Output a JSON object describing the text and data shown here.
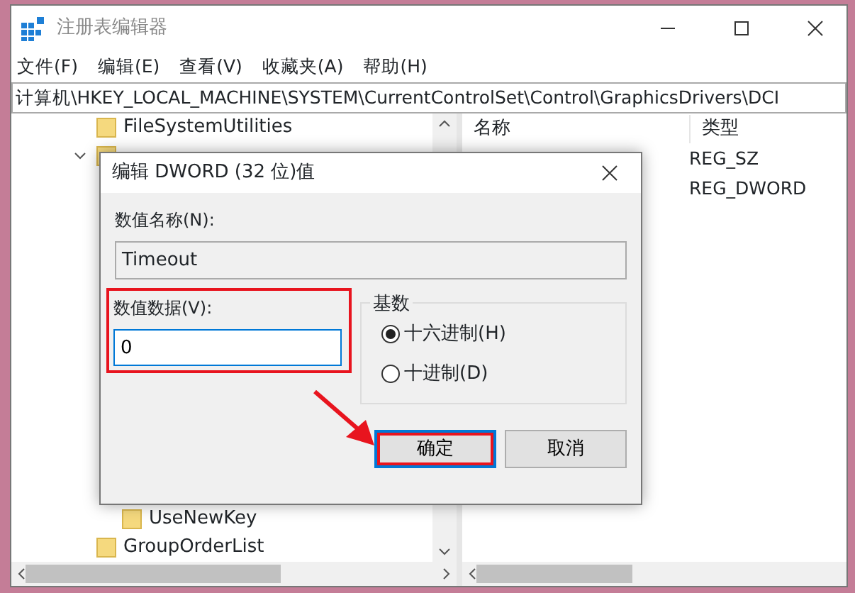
{
  "window": {
    "title": "注册表编辑器"
  },
  "menu": [
    "文件(F)",
    "编辑(E)",
    "查看(V)",
    "收藏夹(A)",
    "帮助(H)"
  ],
  "address": "计算机\\HKEY_LOCAL_MACHINE\\SYSTEM\\CurrentControlSet\\Control\\GraphicsDrivers\\DCI",
  "tree": [
    {
      "label": "FileSystemUtilities"
    },
    {
      "expanded": true,
      "children": [
        {
          "label": "UseNewKey"
        }
      ]
    },
    {
      "label": "GroupOrderList"
    }
  ],
  "values": {
    "columns": [
      "名称",
      "类型"
    ],
    "rows": [
      {
        "type": "REG_SZ"
      },
      {
        "type": "REG_DWORD"
      }
    ]
  },
  "dialog": {
    "title": "编辑 DWORD (32 位)值",
    "name_label": "数值名称(N):",
    "name_value": "Timeout",
    "data_label": "数值数据(V):",
    "data_value": "0",
    "base_title": "基数",
    "radios": [
      {
        "label": "十六进制(H)",
        "selected": true
      },
      {
        "label": "十进制(D)",
        "selected": false
      }
    ],
    "buttons": [
      {
        "label": "确定",
        "default": true,
        "highlighted": true
      },
      {
        "label": "取消",
        "default": false,
        "highlighted": false
      }
    ],
    "data_highlighted": true
  }
}
